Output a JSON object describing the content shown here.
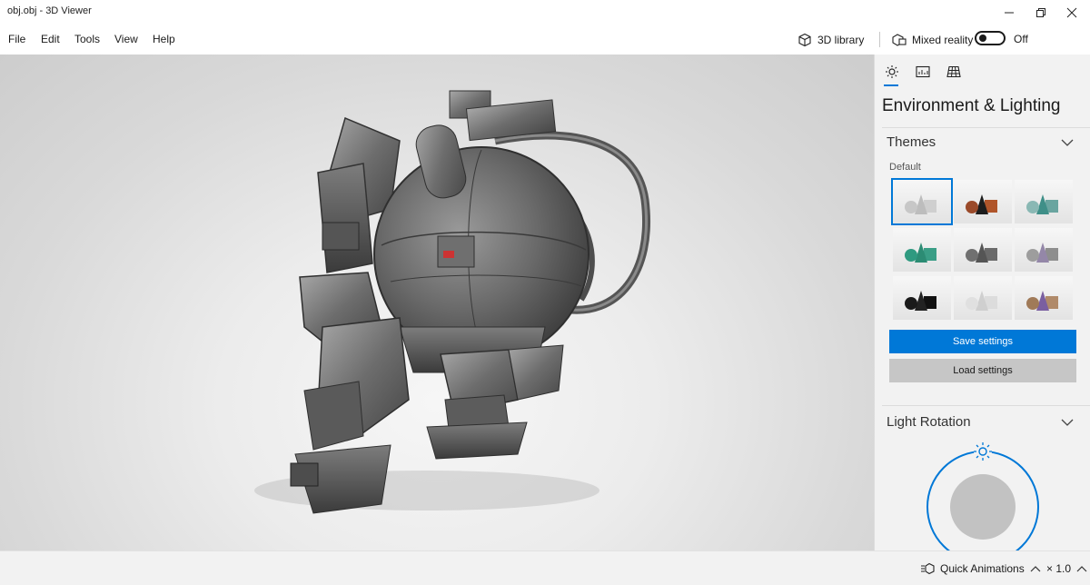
{
  "window": {
    "title": "obj.obj - 3D Viewer"
  },
  "menu": {
    "items": [
      "File",
      "Edit",
      "Tools",
      "View",
      "Help"
    ],
    "library_label": "3D library",
    "mixed_reality_label": "Mixed reality",
    "toggle_state": "Off"
  },
  "panel": {
    "title": "Environment & Lighting",
    "themes": {
      "heading": "Themes",
      "default_label": "Default",
      "selected_index": 0
    },
    "save_label": "Save settings",
    "load_label": "Load settings",
    "light_rotation_heading": "Light Rotation"
  },
  "status": {
    "quick_animations_label": "Quick Animations",
    "speed_label": "× 1.0"
  },
  "colors": {
    "accent": "#0078d7",
    "panel_bg": "#f2f2f2"
  },
  "icons": [
    "minimize-icon",
    "maximize-icon",
    "close-icon",
    "cube-icon",
    "mixed-reality-icon",
    "sun-icon",
    "stats-icon",
    "grid-icon",
    "chevron-down-icon",
    "chevron-up-icon",
    "quick-animations-icon"
  ]
}
